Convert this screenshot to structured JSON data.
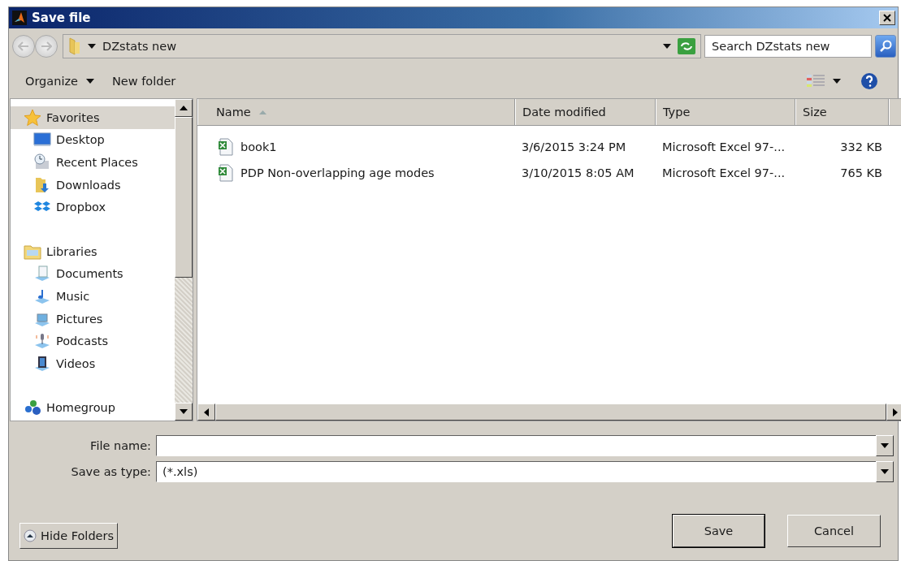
{
  "window": {
    "title": "Save file"
  },
  "address": {
    "path": "DZstats new"
  },
  "search": {
    "placeholder": "Search DZstats new"
  },
  "toolbar": {
    "items": [
      {
        "label": "Organize",
        "kind": "menu"
      },
      {
        "label": "New folder",
        "kind": "button"
      }
    ]
  },
  "nav": {
    "groups": [
      {
        "label": "Favorites",
        "kind": "star",
        "selected": true,
        "children": [
          {
            "label": "Desktop",
            "kind": "desktop",
            "selected": false
          },
          {
            "label": "Recent Places",
            "kind": "recent",
            "selected": false
          },
          {
            "label": "Downloads",
            "kind": "downloads",
            "selected": false
          },
          {
            "label": "Dropbox",
            "kind": "dropbox",
            "selected": false
          }
        ]
      },
      {
        "label": "Libraries",
        "kind": "libraries",
        "selected": false,
        "children": [
          {
            "label": "Documents",
            "kind": "documents",
            "selected": false
          },
          {
            "label": "Music",
            "kind": "music",
            "selected": false
          },
          {
            "label": "Pictures",
            "kind": "pictures",
            "selected": false
          },
          {
            "label": "Podcasts",
            "kind": "podcasts",
            "selected": false
          },
          {
            "label": "Videos",
            "kind": "videos",
            "selected": false
          }
        ]
      },
      {
        "label": "Homegroup",
        "kind": "homegroup",
        "selected": false
      }
    ]
  },
  "files": {
    "columns": [
      {
        "label": "Name",
        "sorted": true
      },
      {
        "label": "Date modified",
        "sorted": false
      },
      {
        "label": "Type",
        "sorted": false
      },
      {
        "label": "Size",
        "sorted": false
      }
    ],
    "rows": [
      {
        "name": "book1",
        "date": "3/6/2015 3:24 PM",
        "type": "Microsoft Excel 97-...",
        "size": "332 KB"
      },
      {
        "name": "PDP Non-overlapping age modes",
        "date": "3/10/2015 8:05 AM",
        "type": "Microsoft Excel 97-...",
        "size": "765 KB"
      }
    ]
  },
  "file_name": {
    "label": "File name:"
  },
  "save_as_type": {
    "label": "Save as type:",
    "value": "(*.xls)"
  },
  "buttons": [
    {
      "label": "Hide Folders",
      "kind": "toggle"
    },
    {
      "label": "Save",
      "kind": "primary"
    },
    {
      "label": "Cancel",
      "kind": "normal"
    }
  ]
}
